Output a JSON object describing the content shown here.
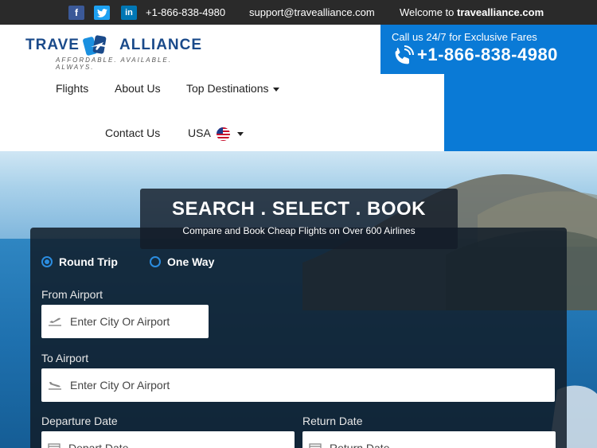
{
  "topbar": {
    "social": {
      "facebook": "f",
      "twitter": "t",
      "linkedin": "in"
    },
    "phone": "+1-866-838-4980",
    "email": "support@travealliance.com",
    "welcome_prefix": "Welcome to ",
    "welcome_site": "travealliance.com"
  },
  "logo": {
    "left": "TRAVE",
    "right": "ALLIANCE",
    "tagline": "AFFORDABLE. AVAILABLE. ALWAYS."
  },
  "nav": {
    "flights": "Flights",
    "about": "About Us",
    "top_destinations": "Top Destinations",
    "contact": "Contact Us",
    "country": "USA"
  },
  "callbox": {
    "label": "Call us 24/7 for Exclusive Fares",
    "phone": "+1-866-838-4980"
  },
  "hero": {
    "title": "SEARCH . SELECT . BOOK",
    "subtitle": "Compare and Book Cheap Flights on Over 600 Airlines"
  },
  "search": {
    "trip_types": [
      "Round Trip",
      "One Way"
    ],
    "selected_trip": "Round Trip",
    "from_label": "From Airport",
    "from_placeholder": "Enter City Or Airport",
    "to_label": "To Airport",
    "to_placeholder": "Enter City Or Airport",
    "depart_label": "Departure Date",
    "depart_placeholder": "Depart Date",
    "return_label": "Return Date",
    "return_placeholder": "Return Date"
  },
  "colors": {
    "accent": "#0a7ad6",
    "topbar": "#2a2a2a",
    "brand": "#1a4a8a"
  }
}
